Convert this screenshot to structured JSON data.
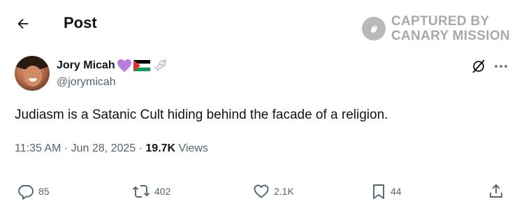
{
  "header": {
    "title": "Post"
  },
  "watermark": {
    "line1": "CAPTURED BY",
    "line2": "CANARY MISSION"
  },
  "tweet": {
    "author_name": "Jory Micah",
    "author_handle": "@jorymicah",
    "name_emojis": [
      "purple-heart-icon",
      "palestine-flag-icon",
      "dove-icon"
    ],
    "text": "Judiasm is a Satanic Cult hiding behind the facade of a religion.",
    "time": "11:35 AM",
    "sep1": " · ",
    "date": "Jun 28, 2025",
    "sep2": " · ",
    "views_count": "19.7K",
    "views_label": " Views"
  },
  "actions": {
    "replies": "85",
    "reposts": "402",
    "likes": "2.1K",
    "bookmarks": "44"
  },
  "colors": {
    "text": "#0f1419",
    "secondary": "#536471",
    "watermark": "#a9a9a9",
    "heart": "#b57edc"
  }
}
